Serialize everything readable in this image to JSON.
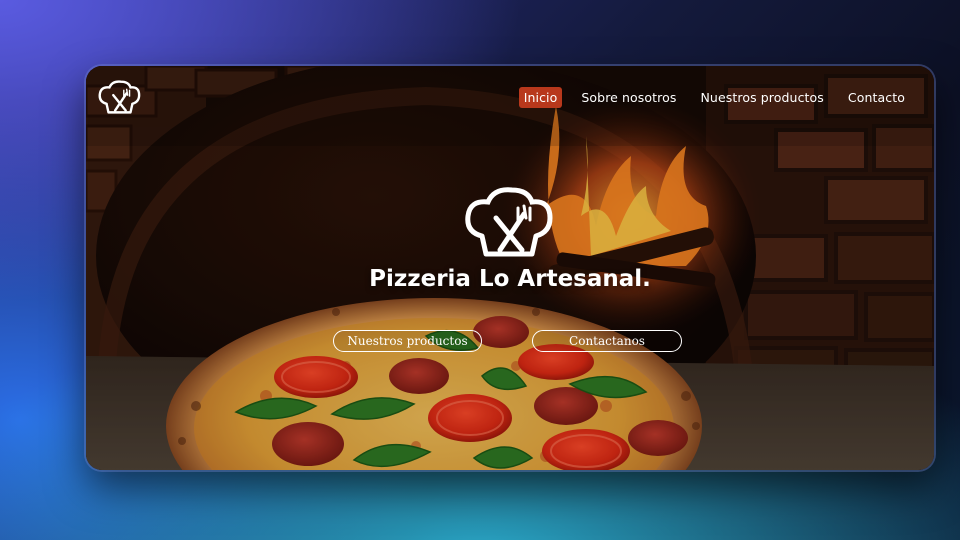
{
  "brand": {
    "title": "Pizzeria Lo Artesanal.",
    "logo_icon": "chef-hat-fork-knife-icon"
  },
  "nav": {
    "items": [
      {
        "label": "Inicio",
        "active": true
      },
      {
        "label": "Sobre nosotros",
        "active": false
      },
      {
        "label": "Nuestros productos",
        "active": false
      },
      {
        "label": "Contacto",
        "active": false
      }
    ]
  },
  "hero": {
    "buttons": {
      "products": "Nuestros productos",
      "contact": "Contactanos"
    },
    "background": "pizza-oven-photo"
  },
  "colors": {
    "accent": "#b8381c",
    "text": "#ffffff"
  }
}
